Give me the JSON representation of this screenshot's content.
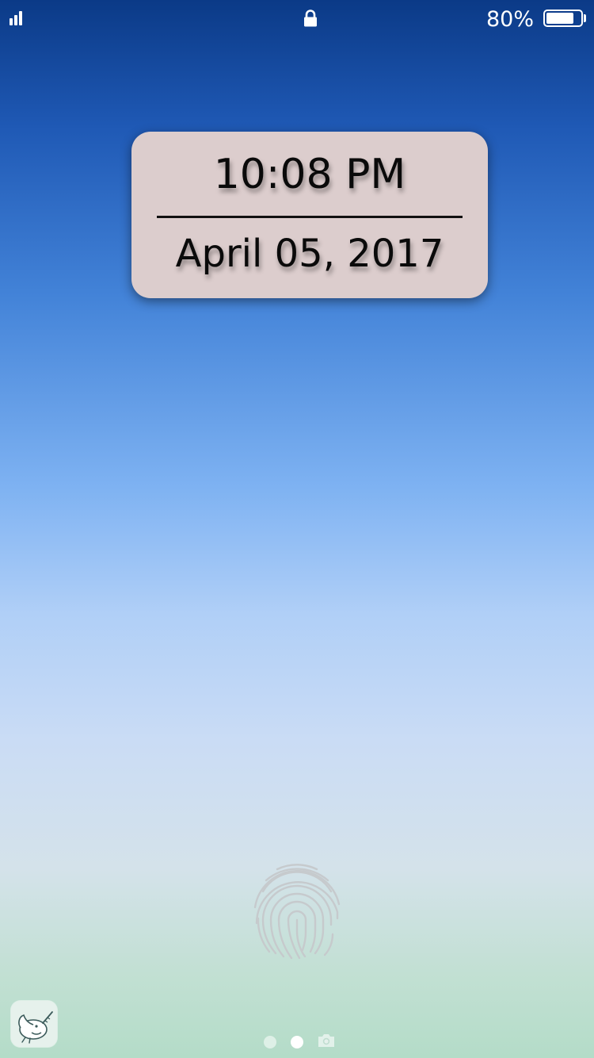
{
  "status_bar": {
    "signal_icon": "signal-bars-icon",
    "lock_icon": "lock-icon",
    "battery_percent_label": "80%",
    "battery_level": 0.8,
    "battery_icon": "battery-icon"
  },
  "clock": {
    "time": "10:08 PM",
    "date": "April 05, 2017"
  },
  "bottom": {
    "fingerprint_icon": "fingerprint-icon",
    "app_icon": "narwhal-app-icon",
    "page_indicator": {
      "pages": 2,
      "active_page": 2,
      "trailing_icon": "camera-icon"
    }
  },
  "colors": {
    "card_background": "#dccdcd",
    "gradient_top": "#0b3a87",
    "gradient_middle": "#b0cff7",
    "gradient_bottom": "#b4dcc8"
  }
}
